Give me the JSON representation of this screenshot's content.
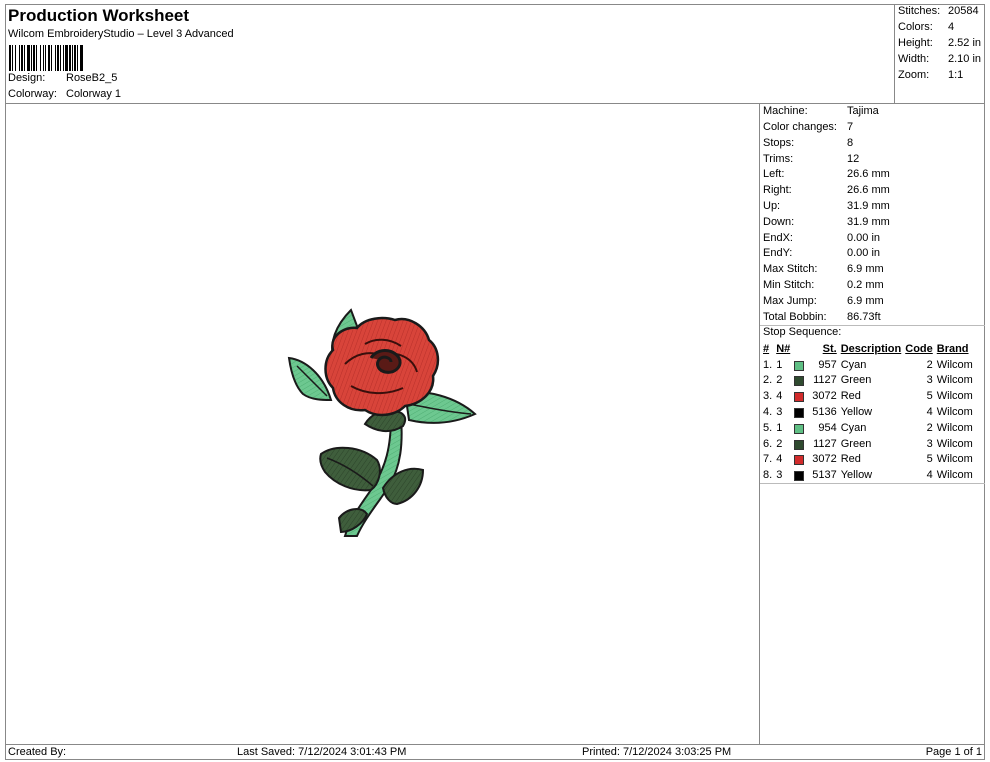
{
  "header": {
    "title": "Production Worksheet",
    "subtitle": "Wilcom EmbroideryStudio – Level 3 Advanced",
    "design_label": "Design:",
    "design_value": "RoseB2_5",
    "colorway_label": "Colorway:",
    "colorway_value": "Colorway 1"
  },
  "summary": {
    "stitches_label": "Stitches:",
    "stitches_value": "20584",
    "colors_label": "Colors:",
    "colors_value": "4",
    "height_label": "Height:",
    "height_value": "2.52 in",
    "width_label": "Width:",
    "width_value": "2.10 in",
    "zoom_label": "Zoom:",
    "zoom_value": "1:1"
  },
  "info": {
    "machine_label": "Machine:",
    "machine_value": "Tajima",
    "color_changes_label": "Color changes:",
    "color_changes_value": "7",
    "stops_label": "Stops:",
    "stops_value": "8",
    "trims_label": "Trims:",
    "trims_value": "12",
    "left_label": "Left:",
    "left_value": "26.6 mm",
    "right_label": "Right:",
    "right_value": "26.6 mm",
    "up_label": "Up:",
    "up_value": "31.9 mm",
    "down_label": "Down:",
    "down_value": "31.9 mm",
    "endx_label": "EndX:",
    "endx_value": "0.00 in",
    "endy_label": "EndY:",
    "endy_value": "0.00 in",
    "max_stitch_label": "Max Stitch:",
    "max_stitch_value": "6.9 mm",
    "min_stitch_label": "Min Stitch:",
    "min_stitch_value": "0.2 mm",
    "max_jump_label": "Max Jump:",
    "max_jump_value": "6.9 mm",
    "total_bobbin_label": "Total Bobbin:",
    "total_bobbin_value": "86.73ft",
    "stop_sequence_label": "Stop Sequence:"
  },
  "sequence": {
    "headers": {
      "num": "#",
      "n": "N#",
      "st": "St.",
      "description": "Description",
      "code": "Code",
      "brand": "Brand"
    },
    "rows": [
      {
        "num": "1.",
        "n": "1",
        "color": "#5fbf84",
        "st": "957",
        "description": "Cyan",
        "code": "2",
        "brand": "Wilcom"
      },
      {
        "num": "2.",
        "n": "2",
        "color": "#2f4a2f",
        "st": "1127",
        "description": "Green",
        "code": "3",
        "brand": "Wilcom"
      },
      {
        "num": "3.",
        "n": "4",
        "color": "#d22b2b",
        "st": "3072",
        "description": "Red",
        "code": "5",
        "brand": "Wilcom"
      },
      {
        "num": "4.",
        "n": "3",
        "color": "#000000",
        "st": "5136",
        "description": "Yellow",
        "code": "4",
        "brand": "Wilcom"
      },
      {
        "num": "5.",
        "n": "1",
        "color": "#5fbf84",
        "st": "954",
        "description": "Cyan",
        "code": "2",
        "brand": "Wilcom"
      },
      {
        "num": "6.",
        "n": "2",
        "color": "#2f4a2f",
        "st": "1127",
        "description": "Green",
        "code": "3",
        "brand": "Wilcom"
      },
      {
        "num": "7.",
        "n": "4",
        "color": "#d22b2b",
        "st": "3072",
        "description": "Red",
        "code": "5",
        "brand": "Wilcom"
      },
      {
        "num": "8.",
        "n": "3",
        "color": "#000000",
        "st": "5137",
        "description": "Yellow",
        "code": "4",
        "brand": "Wilcom"
      }
    ]
  },
  "footer": {
    "created_by": "Created By:",
    "last_saved": "Last Saved: 7/12/2024 3:01:43 PM",
    "printed": "Printed: 7/12/2024 3:03:25 PM",
    "page": "Page 1 of 1"
  },
  "colors": {
    "petal_red": "#d8443a",
    "petal_dark": "#5a1a16",
    "leaf_dark": "#3d5a3a",
    "leaf_light": "#69c48c",
    "outline": "#1a1a1a"
  },
  "icons": {
    "barcode": "barcode-icon",
    "design_preview": "rose-embroidery-image"
  }
}
